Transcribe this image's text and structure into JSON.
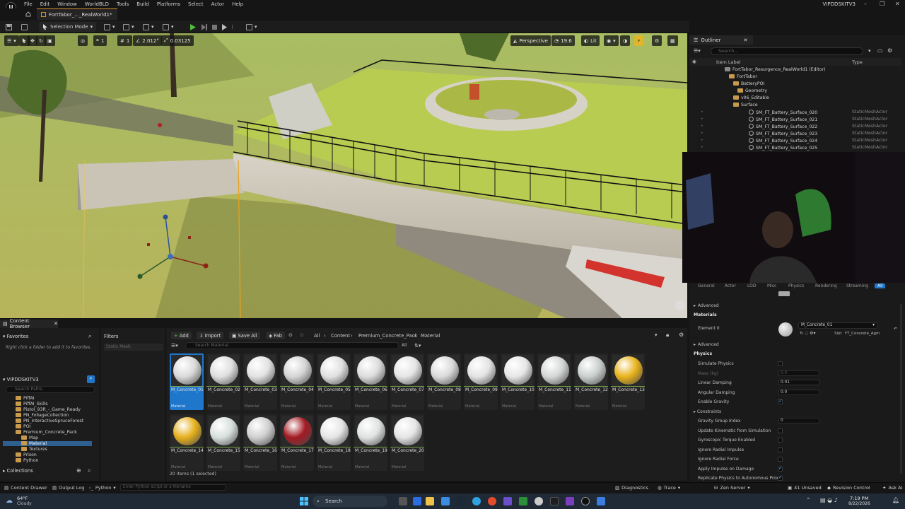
{
  "menubar": {
    "items": [
      "File",
      "Edit",
      "Window",
      "WorldBLD",
      "Tools",
      "Build",
      "Platforms",
      "Select",
      "Actor",
      "Help"
    ],
    "project_name": "VIPDDSKITV3"
  },
  "level_tab": "FortTabor_..._RealWorld1*",
  "toolbar": {
    "selection_mode": "Selection Mode"
  },
  "viewport": {
    "snap_grid": "1",
    "rotation": "2.012°",
    "scale": "0.03125",
    "perspective": "Perspective",
    "fov": "19.6",
    "view_mode": "Lit"
  },
  "outliner": {
    "tab": "Outliner",
    "search_placeholder": "Search...",
    "col_label": "Item Label",
    "col_type": "Type",
    "rows": [
      {
        "label": "FortTabor_Resurgence_RealWorld1 (Editor)",
        "type": "",
        "kind": "level"
      },
      {
        "label": "FortTabor",
        "type": "",
        "kind": "folder"
      },
      {
        "label": "BatteryPOI",
        "type": "",
        "kind": "folder"
      },
      {
        "label": "Geometry",
        "type": "",
        "kind": "folder"
      },
      {
        "label": "v06_Editable",
        "type": "",
        "kind": "folder"
      },
      {
        "label": "Surface",
        "type": "",
        "kind": "folder"
      },
      {
        "label": "SM_FT_Battery_Surface_020",
        "type": "StaticMeshActor",
        "kind": "mesh"
      },
      {
        "label": "SM_FT_Battery_Surface_021",
        "type": "StaticMeshActor",
        "kind": "mesh"
      },
      {
        "label": "SM_FT_Battery_Surface_022",
        "type": "StaticMeshActor",
        "kind": "mesh"
      },
      {
        "label": "SM_FT_Battery_Surface_023",
        "type": "StaticMeshActor",
        "kind": "mesh"
      },
      {
        "label": "SM_FT_Battery_Surface_024",
        "type": "StaticMeshActor",
        "kind": "mesh"
      },
      {
        "label": "SM_FT_Battery_Surface_025",
        "type": "StaticMeshActor",
        "kind": "mesh"
      }
    ]
  },
  "details": {
    "tabs": [
      "General",
      "Actor",
      "LOD",
      "Misc",
      "Physics",
      "Rendering",
      "Streaming",
      "All"
    ],
    "advanced_label": "Advanced",
    "materials_section": "Materials",
    "element_label": "Element 0",
    "element_material": "M_Concrete_01",
    "slot_label": "Slot",
    "slot_value": "FT_Concrete_Agm",
    "advanced_label_2": "Advanced",
    "physics_section": "Physics",
    "physics_props": [
      {
        "label": "Simulate Physics",
        "kind": "check",
        "checked": false
      },
      {
        "label": "Mass (kg)",
        "kind": "num",
        "value": "0.0",
        "dim": true
      },
      {
        "label": "Linear Damping",
        "kind": "num",
        "value": "0.01"
      },
      {
        "label": "Angular Damping",
        "kind": "num",
        "value": "0.0"
      },
      {
        "label": "Enable Gravity",
        "kind": "check",
        "checked": true
      },
      {
        "label": "Constraints",
        "kind": "section"
      },
      {
        "label": "Gravity Group Index",
        "kind": "num",
        "value": "0"
      },
      {
        "label": "Update Kinematic from Simulation",
        "kind": "check",
        "checked": false
      },
      {
        "label": "Gyroscopic Torque Enabled",
        "kind": "check",
        "checked": false
      },
      {
        "label": "Ignore Radial Impulse",
        "kind": "check",
        "checked": false
      },
      {
        "label": "Ignore Radial Force",
        "kind": "check",
        "checked": false
      },
      {
        "label": "Apply Impulse on Damage",
        "kind": "check",
        "checked": true
      },
      {
        "label": "Replicate Physics to Autonomous Proxy",
        "kind": "check",
        "checked": true
      }
    ]
  },
  "content_browser": {
    "tab": "Content Browser",
    "favorites": "Favorites",
    "favorites_hint": "Right click a folder to add it to favorites.",
    "project_root": "VIPDDSKITV3",
    "search_paths_placeholder": "Search Paths",
    "tree": [
      {
        "label": "PiffAI",
        "sel": false
      },
      {
        "label": "PiffAI_Skills",
        "sel": false
      },
      {
        "label": "Pistol_93R_-_Game_Ready",
        "sel": false
      },
      {
        "label": "PN_FoliageCollection",
        "sel": false
      },
      {
        "label": "PN_interactiveSpruceForest",
        "sel": false
      },
      {
        "label": "POI",
        "sel": false
      },
      {
        "label": "Premium_Concrete_Pack",
        "sel": false
      },
      {
        "label": "Map",
        "sel": false
      },
      {
        "label": "Material",
        "sel": true
      },
      {
        "label": "Textures",
        "sel": false
      },
      {
        "label": "Prison",
        "sel": false
      },
      {
        "label": "Python",
        "sel": false
      }
    ],
    "collections": "Collections",
    "filters": "Filters",
    "filter_placeholder": "Static Mesh",
    "add_label": "Add",
    "import_label": "Import",
    "save_all_label": "Save All",
    "fab_label": "Fab",
    "breadcrumb": [
      "All",
      "Content",
      "Premium_Concrete_Pack",
      "Material"
    ],
    "search_placeholder": "Search Material",
    "items_count": "20 items (1 selected)",
    "asset_type": "Material",
    "assets": [
      {
        "name": "M_Concrete_01",
        "color": "#d9d9d9",
        "sel": true
      },
      {
        "name": "M_Concrete_02",
        "color": "#dedede"
      },
      {
        "name": "M_Concrete_03",
        "color": "#e2e2e2"
      },
      {
        "name": "M_Concrete_04",
        "color": "#d4d4d4"
      },
      {
        "name": "M_Concrete_05",
        "color": "#e0e0e0"
      },
      {
        "name": "M_Concrete_06",
        "color": "#dcdcdc"
      },
      {
        "name": "M_Concrete_07",
        "color": "#e4e4e4"
      },
      {
        "name": "M_Concrete_08",
        "color": "#dadada"
      },
      {
        "name": "M_Concrete_09",
        "color": "#e3e3e3"
      },
      {
        "name": "M_Concrete_10",
        "color": "#e6e6e6"
      },
      {
        "name": "M_Concrete_11",
        "color": "#d2d6d4"
      },
      {
        "name": "M_Concrete_12",
        "color": "#c9cfcc"
      },
      {
        "name": "M_Concrete_13",
        "color": "#e8b21a"
      },
      {
        "name": "M_Concrete_14",
        "color": "#e6b01c"
      },
      {
        "name": "M_Concrete_15",
        "color": "#d7dfdc"
      },
      {
        "name": "M_Concrete_16",
        "color": "#cfcfcf"
      },
      {
        "name": "M_Concrete_17",
        "color": "#a31a22"
      },
      {
        "name": "M_Concrete_18",
        "color": "#e6e6e6"
      },
      {
        "name": "M_Concrete_19",
        "color": "#dfe2e1"
      },
      {
        "name": "M_Concrete_20",
        "color": "#e5e5e5"
      }
    ]
  },
  "statusbar": {
    "content_drawer": "Content Drawer",
    "output_log": "Output Log",
    "cmd": "Python",
    "cmd_placeholder": "Enter Python script or a filename",
    "diagnostics": "Diagnostics",
    "trace": "Trace",
    "zen": "Zen Server",
    "unsaved": "41 Unsaved",
    "revision": "Revision Control",
    "ask": "Ask AI"
  },
  "taskbar": {
    "temp": "64°F",
    "weather": "Cloudy",
    "search": "Search",
    "time": "7:19 PM",
    "date": "8/22/2026"
  }
}
